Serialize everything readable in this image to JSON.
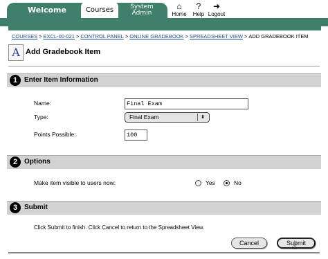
{
  "nav": {
    "tabs": [
      "Welcome",
      "Courses",
      "System",
      "Admin"
    ],
    "icons": [
      {
        "name": "home",
        "label": "Home"
      },
      {
        "name": "help",
        "label": "Help"
      },
      {
        "name": "logout",
        "label": "Logout"
      }
    ]
  },
  "breadcrumb": {
    "items": [
      "COURSES",
      "EXCL-00-021",
      "CONTROL PANEL",
      "ONLINE GRADEBOOK",
      "SPREADSHEET VIEW"
    ],
    "current": "ADD GRADEBOOK ITEM",
    "separator": ">"
  },
  "page": {
    "title": "Add Gradebook Item"
  },
  "sections": {
    "one": {
      "number": "1",
      "title": "Enter Item Information"
    },
    "two": {
      "number": "2",
      "title": "Options"
    },
    "three": {
      "number": "3",
      "title": "Submit"
    }
  },
  "form": {
    "name_label": "Name:",
    "name_value": "Final Exam",
    "type_label": "Type:",
    "type_value": "Final Exam",
    "points_label": "Points Possible:",
    "points_value": "100",
    "visible_label": "Make item visible to users now:",
    "yes_label": "Yes",
    "no_label": "No",
    "visible_selected": "No"
  },
  "submit": {
    "instructions": "Click Submit to finish. Click Cancel to return to the Spreadsheet View.",
    "cancel_label": "Cancel",
    "submit_label": "Submit"
  },
  "colors": {
    "nav_bg": "#3f7f6b",
    "section_bg": "#d2d2d2",
    "link": "#1a4a8a"
  }
}
